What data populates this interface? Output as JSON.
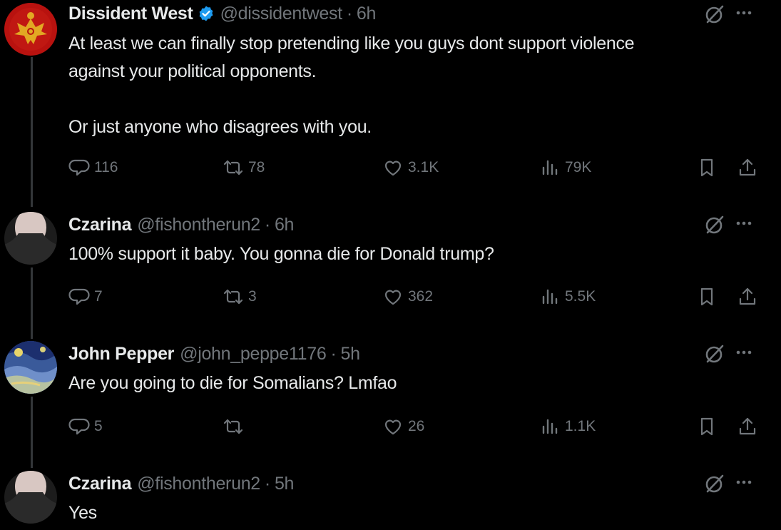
{
  "tweets": [
    {
      "name": "Dissident West",
      "verified": true,
      "handle": "@dissidentwest",
      "time": "6h",
      "text": "At least we can finally stop pretending like you guys dont support violence\nagainst your political opponents.\n\nOr just anyone who disagrees with you.",
      "replies": "116",
      "retweets": "78",
      "likes": "3.1K",
      "views": "79K"
    },
    {
      "name": "Czarina",
      "verified": false,
      "handle": "@fishontherun2",
      "time": "6h",
      "text": "100% support it baby. You gonna die for Donald trump?",
      "replies": "7",
      "retweets": "3",
      "likes": "362",
      "views": "5.5K"
    },
    {
      "name": "John Pepper",
      "verified": false,
      "handle": "@john_peppe1176",
      "time": "5h",
      "text": "Are you going to die for Somalians? Lmfao",
      "replies": "5",
      "retweets": "",
      "likes": "26",
      "views": "1.1K"
    },
    {
      "name": "Czarina",
      "verified": false,
      "handle": "@fishontherun2",
      "time": "5h",
      "text": "Yes"
    }
  ],
  "separator": "·",
  "icons": {
    "reply": "reply-icon",
    "retweet": "retweet-icon",
    "like": "heart-icon",
    "views": "views-icon",
    "bookmark": "bookmark-icon",
    "share": "share-icon",
    "grok": "grok-icon",
    "more": "more-icon",
    "verified": "verified-badge-icon"
  },
  "colors": {
    "background": "#000000",
    "text": "#e7e9ea",
    "muted": "#71767b",
    "verified": "#1d9bf0",
    "thread_line": "#333639"
  }
}
